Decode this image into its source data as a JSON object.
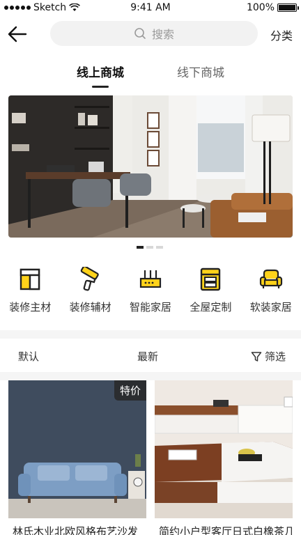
{
  "status_bar": {
    "carrier": "Sketch",
    "time": "9:41 AM",
    "battery": "100%",
    "battery_level": 1.0
  },
  "nav": {
    "search_placeholder": "搜索",
    "category_label": "分类"
  },
  "tabs": [
    {
      "label": "线上商城",
      "active": true
    },
    {
      "label": "线下商城",
      "active": false
    }
  ],
  "banner": {
    "page_count": 3,
    "current_page": 1
  },
  "categories": [
    {
      "label": "装修主材",
      "icon": "cabinet-icon"
    },
    {
      "label": "装修辅材",
      "icon": "paint-roller-icon"
    },
    {
      "label": "智能家居",
      "icon": "router-icon"
    },
    {
      "label": "全屋定制",
      "icon": "wardrobe-icon"
    },
    {
      "label": "软装家居",
      "icon": "armchair-icon"
    }
  ],
  "sort": {
    "default_label": "默认",
    "newest_label": "最新",
    "filter_label": "筛选"
  },
  "products": [
    {
      "title": "林氏木业北欧风格布艺沙发",
      "badge": "特价"
    },
    {
      "title": "简约小户型客厅日式白橡茶几"
    }
  ],
  "colors": {
    "accent": "#FFD31A",
    "text": "#222222",
    "muted": "#9A9A9A"
  }
}
